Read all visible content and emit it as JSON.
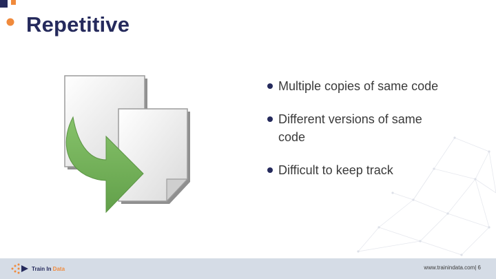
{
  "slide": {
    "title": "Repetitive",
    "bullets": [
      "Multiple copies of same code",
      "Different versions of same code",
      "Difficult to keep track"
    ]
  },
  "footer": {
    "logo_text_main": "Train In ",
    "logo_text_accent": "Data",
    "url": "www.trainindata.com",
    "separator": "|",
    "page_number": "6"
  },
  "icons": [
    "copy-documents-icon",
    "logo-mark-icon"
  ],
  "colors": {
    "title": "#252a5c",
    "accent_orange": "#f08a3c",
    "arrow_green": "#76b05a",
    "footer_bg": "#d5dce6"
  }
}
